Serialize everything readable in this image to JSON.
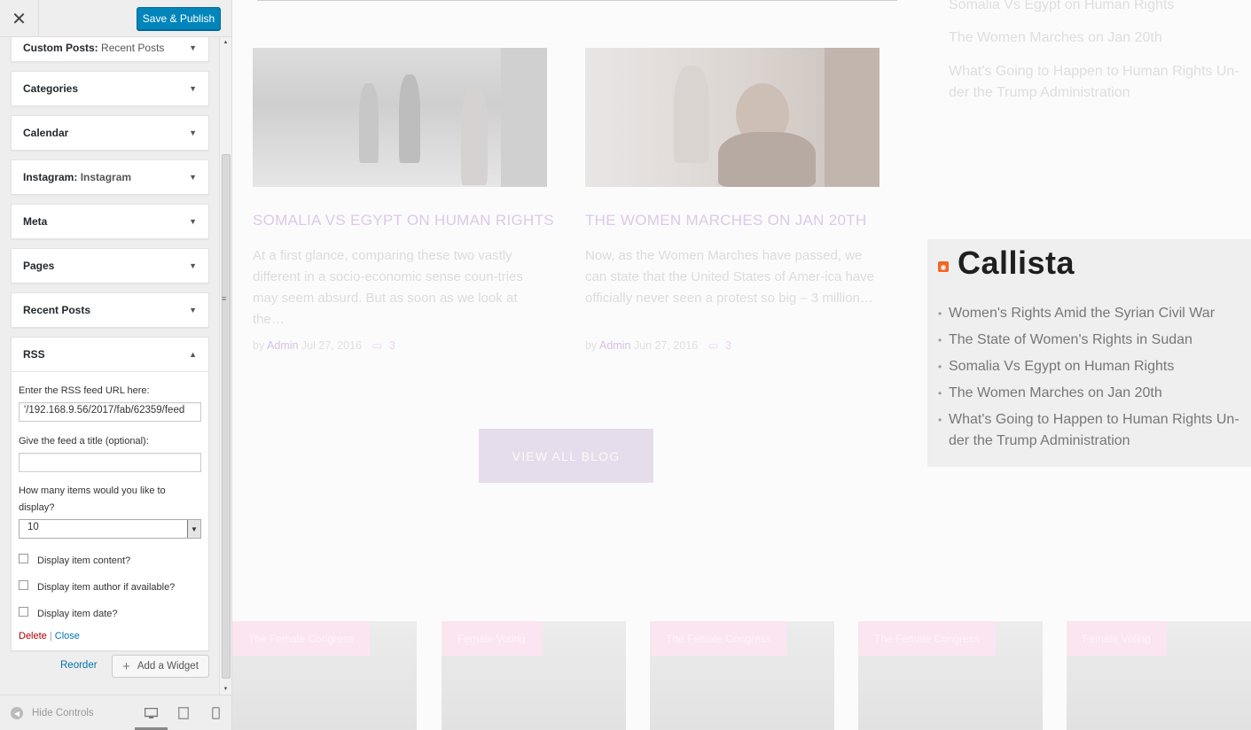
{
  "topbar": {
    "close_glyph": "✕",
    "publish_label": "Save & Publish"
  },
  "widgets": [
    {
      "title": "Custom Posts:",
      "subtitle": "Recent Posts"
    },
    {
      "title": "Categories",
      "subtitle": ""
    },
    {
      "title": "Calendar",
      "subtitle": ""
    },
    {
      "title": "Instagram:",
      "subtitle": "Instagram"
    },
    {
      "title": "Meta",
      "subtitle": ""
    },
    {
      "title": "Pages",
      "subtitle": ""
    },
    {
      "title": "Recent Posts",
      "subtitle": ""
    },
    {
      "title": "RSS",
      "subtitle": ""
    }
  ],
  "rss_form": {
    "url_label": "Enter the RSS feed URL here:",
    "url_value": "'/192.168.9.56/2017/fab/62359/feed",
    "title_label": "Give the feed a title (optional):",
    "title_value": "",
    "items_label": "How many items would you like to display?",
    "items_value": "10",
    "check_content": "Display item content?",
    "check_author": "Display item author if available?",
    "check_date": "Display item date?",
    "delete_label": "Delete",
    "separator": "|",
    "close_label": "Close"
  },
  "actions": {
    "reorder_label": "Reorder",
    "add_widget_label": "Add a Widget",
    "add_icon": "+"
  },
  "footer": {
    "hide_controls_label": "Hide Controls"
  },
  "preview": {
    "posts": [
      {
        "title": "Somalia Vs Egypt on Human Rights",
        "excerpt": "At a first glance, comparing these two vastly different in a socio-economic sense coun-tries may seem absurd. But as soon as we look at the…",
        "by": "by",
        "author": "Admin",
        "date": "Jul 27, 2016",
        "comments": "3"
      },
      {
        "title": "The Women Marches on Jan 20th",
        "excerpt": "Now, as the Women Marches have passed, we can state that the United States of Amer-ica have officially never seen a protest so big – 3 million…",
        "by": "by",
        "author": "Admin",
        "date": "Jun 27, 2016",
        "comments": "3"
      }
    ],
    "view_all_label": "VIEW ALL BLOG",
    "top_list": [
      "Somalia Vs Egypt on Human Rights",
      "The Women Marches on Jan 20th",
      "What's Going to Happen to Human Rights Un-der the Trump Administration"
    ],
    "rss_widget": {
      "title": "Callista",
      "items": [
        "Women's Rights Amid the Syrian Civil War",
        "The State of Women's Rights in Sudan",
        "Somalia Vs Egypt on Human Rights",
        "The Women Marches on Jan 20th",
        "What's Going to Happen to Human Rights Un-der the Trump Administration"
      ]
    },
    "gallery_tags": [
      "The Female Congress",
      "Female Voting",
      "The Female Congress",
      "The Female Congress",
      "Female Voting"
    ]
  }
}
